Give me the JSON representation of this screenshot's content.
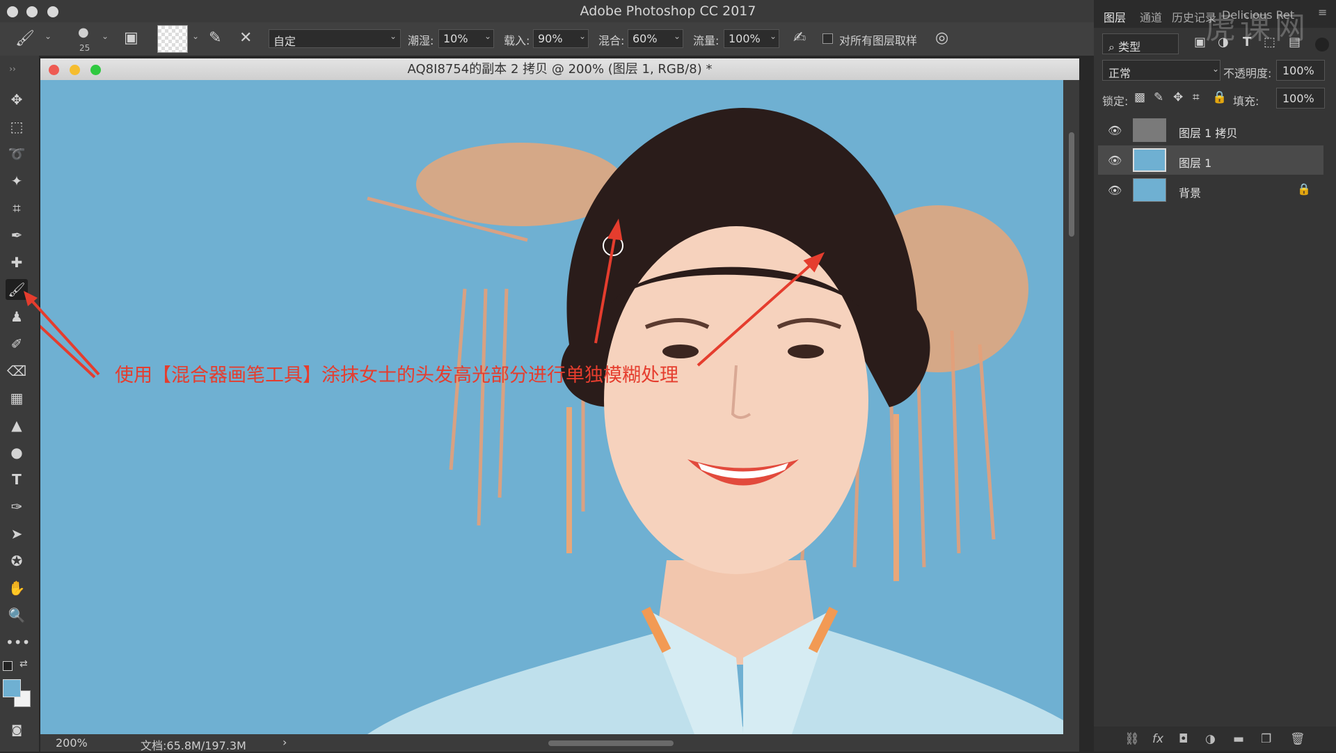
{
  "app": {
    "title": "Adobe Photoshop CC 2017"
  },
  "options": {
    "brush_size": "25",
    "preset": "自定",
    "wet_label": "潮湿:",
    "wet_value": "10%",
    "load_label": "载入:",
    "load_value": "90%",
    "mix_label": "混合:",
    "mix_value": "60%",
    "flow_label": "流量:",
    "flow_value": "100%",
    "sample_all_label": "对所有图层取样"
  },
  "document": {
    "title": "AQ8I8754的副本 2 拷贝 @ 200% (图层 1, RGB/8) *",
    "zoom": "200%",
    "doc_size": "文档:65.8M/197.3M"
  },
  "annotation": {
    "text": "使用【混合器画笔工具】涂抹女士的头发高光部分进行单独模糊处理"
  },
  "panel": {
    "tabs": [
      "图层",
      "通道",
      "历史记录",
      "Delicious Ret"
    ],
    "filter_label": "类型",
    "blend_mode": "正常",
    "opacity_label": "不透明度:",
    "opacity_value": "100%",
    "lock_label": "锁定:",
    "fill_label": "填充:",
    "fill_value": "100%",
    "layers": [
      {
        "name": "图层 1 拷贝"
      },
      {
        "name": "图层 1"
      },
      {
        "name": "背景"
      }
    ]
  },
  "watermark": "虎课网",
  "colors": {
    "accent_red": "#e53d2e",
    "canvas_bg": "#6fb0d2"
  }
}
